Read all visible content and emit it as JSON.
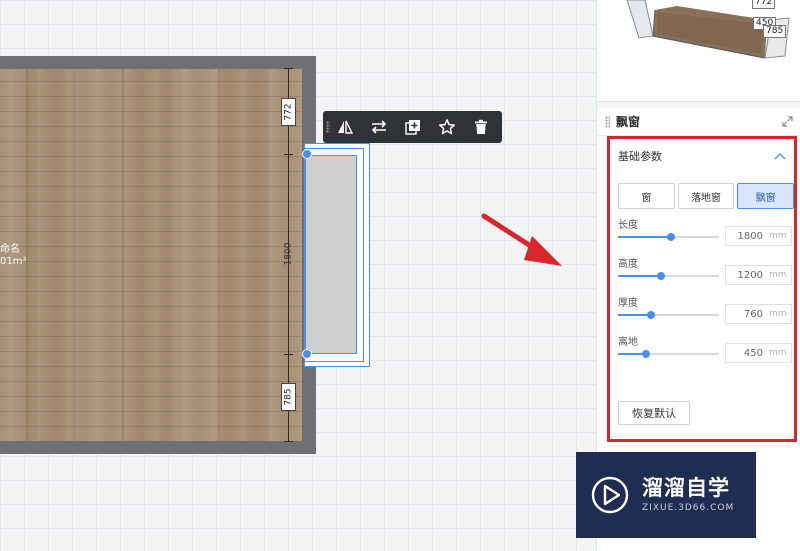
{
  "canvas": {
    "room": {
      "name_partial": "命名",
      "area_partial": "01m²"
    },
    "dimensions": {
      "top": "772",
      "middle": "1800",
      "bottom": "785"
    }
  },
  "toolbar": {
    "buttons": [
      {
        "id": "mirror",
        "icon": "mirror-icon"
      },
      {
        "id": "flip",
        "icon": "swap-icon"
      },
      {
        "id": "duplicate",
        "icon": "duplicate-icon"
      },
      {
        "id": "favorite",
        "icon": "star-icon"
      },
      {
        "id": "delete",
        "icon": "trash-icon"
      }
    ]
  },
  "preview": {
    "tag_top": "772",
    "tag_mid": "450",
    "tag_bottom": "785"
  },
  "panel": {
    "title": "飘窗",
    "section": {
      "title": "基础参数",
      "types": [
        {
          "label": "窗",
          "active": false
        },
        {
          "label": "落地窗",
          "active": false
        },
        {
          "label": "飘窗",
          "active": true
        }
      ],
      "params": [
        {
          "label": "长度",
          "value": "1800",
          "unit": "mm",
          "level": 0.52
        },
        {
          "label": "高度",
          "value": "1200",
          "unit": "mm",
          "level": 0.43
        },
        {
          "label": "厚度",
          "value": "760",
          "unit": "mm",
          "level": 0.33
        },
        {
          "label": "离地",
          "value": "450",
          "unit": "mm",
          "level": 0.28
        }
      ],
      "reset_label": "恢复默认"
    }
  },
  "watermark": {
    "main": "溜溜自学",
    "sub": "ZIXUE.3D66.COM"
  },
  "colors": {
    "accent": "#4a8ef0",
    "highlight": "#d9262a",
    "toolbar": "#2f3237"
  }
}
